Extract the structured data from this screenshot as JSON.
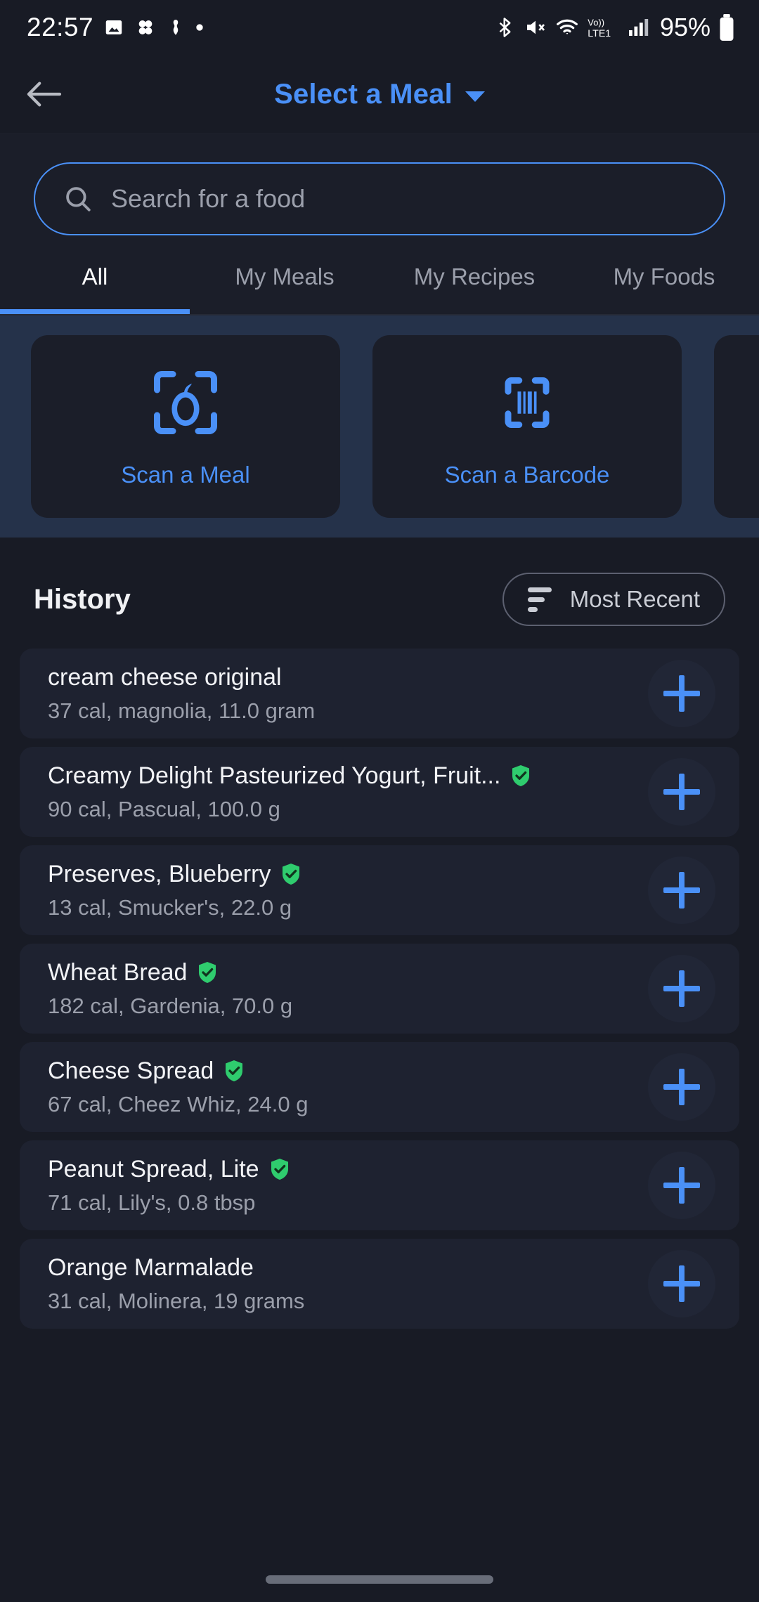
{
  "status_bar": {
    "time": "22:57",
    "battery_percent": "95%",
    "left_icons": [
      "image-icon",
      "dots-icon",
      "anchor-icon",
      "dot-icon"
    ],
    "right_icons": [
      "bluetooth-icon",
      "mute-icon",
      "wifi-icon",
      "volte-lte1-icon",
      "signal-icon",
      "battery-icon"
    ]
  },
  "app_bar": {
    "back_icon": "back-arrow-icon",
    "title": "Select a Meal",
    "dropdown_icon": "chevron-down-icon",
    "title_color": "#4a90f7"
  },
  "search": {
    "placeholder": "Search for a food",
    "icon": "search-icon",
    "value": "",
    "border_color": "#4a90f7"
  },
  "tabs": {
    "items": [
      {
        "label": "All",
        "active": true
      },
      {
        "label": "My Meals",
        "active": false
      },
      {
        "label": "My Recipes",
        "active": false
      },
      {
        "label": "My Foods",
        "active": false
      }
    ],
    "indicator_color": "#4a90f7"
  },
  "scan_actions": {
    "background": "#25324a",
    "cards": [
      {
        "label": "Scan a Meal",
        "icon": "scan-meal-icon"
      },
      {
        "label": "Scan a Barcode",
        "icon": "scan-barcode-icon"
      },
      {
        "label": "",
        "icon": "scan-partial-icon"
      }
    ]
  },
  "history": {
    "title": "History",
    "sort": {
      "label": "Most Recent",
      "icon": "sort-descending-icon"
    },
    "items": [
      {
        "name": "cream cheese original",
        "details": "37 cal, magnolia, 11.0 gram",
        "verified": false,
        "add_icon": "plus-icon"
      },
      {
        "name": "Creamy Delight Pasteurized Yogurt, Fruit...",
        "details": "90 cal, Pascual, 100.0 g",
        "verified": true,
        "add_icon": "plus-icon"
      },
      {
        "name": "Preserves, Blueberry",
        "details": "13 cal, Smucker's, 22.0 g",
        "verified": true,
        "add_icon": "plus-icon"
      },
      {
        "name": "Wheat Bread",
        "details": "182 cal, Gardenia, 70.0 g",
        "verified": true,
        "add_icon": "plus-icon"
      },
      {
        "name": "Cheese Spread",
        "details": "67 cal, Cheez Whiz, 24.0 g",
        "verified": true,
        "add_icon": "plus-icon"
      },
      {
        "name": "Peanut Spread, Lite",
        "details": "71 cal, Lily's, 0.8 tbsp",
        "verified": true,
        "add_icon": "plus-icon"
      },
      {
        "name": "Orange Marmalade",
        "details": "31 cal, Molinera, 19 grams",
        "verified": false,
        "add_icon": "plus-icon"
      }
    ]
  },
  "colors": {
    "background": "#181b25",
    "card": "#1e2230",
    "accent": "#4a90f7",
    "verified_green": "#2fcc6e",
    "text_primary": "#f2f3f6",
    "text_secondary": "#9b9fab"
  },
  "gesture_bar": {
    "present": true
  }
}
